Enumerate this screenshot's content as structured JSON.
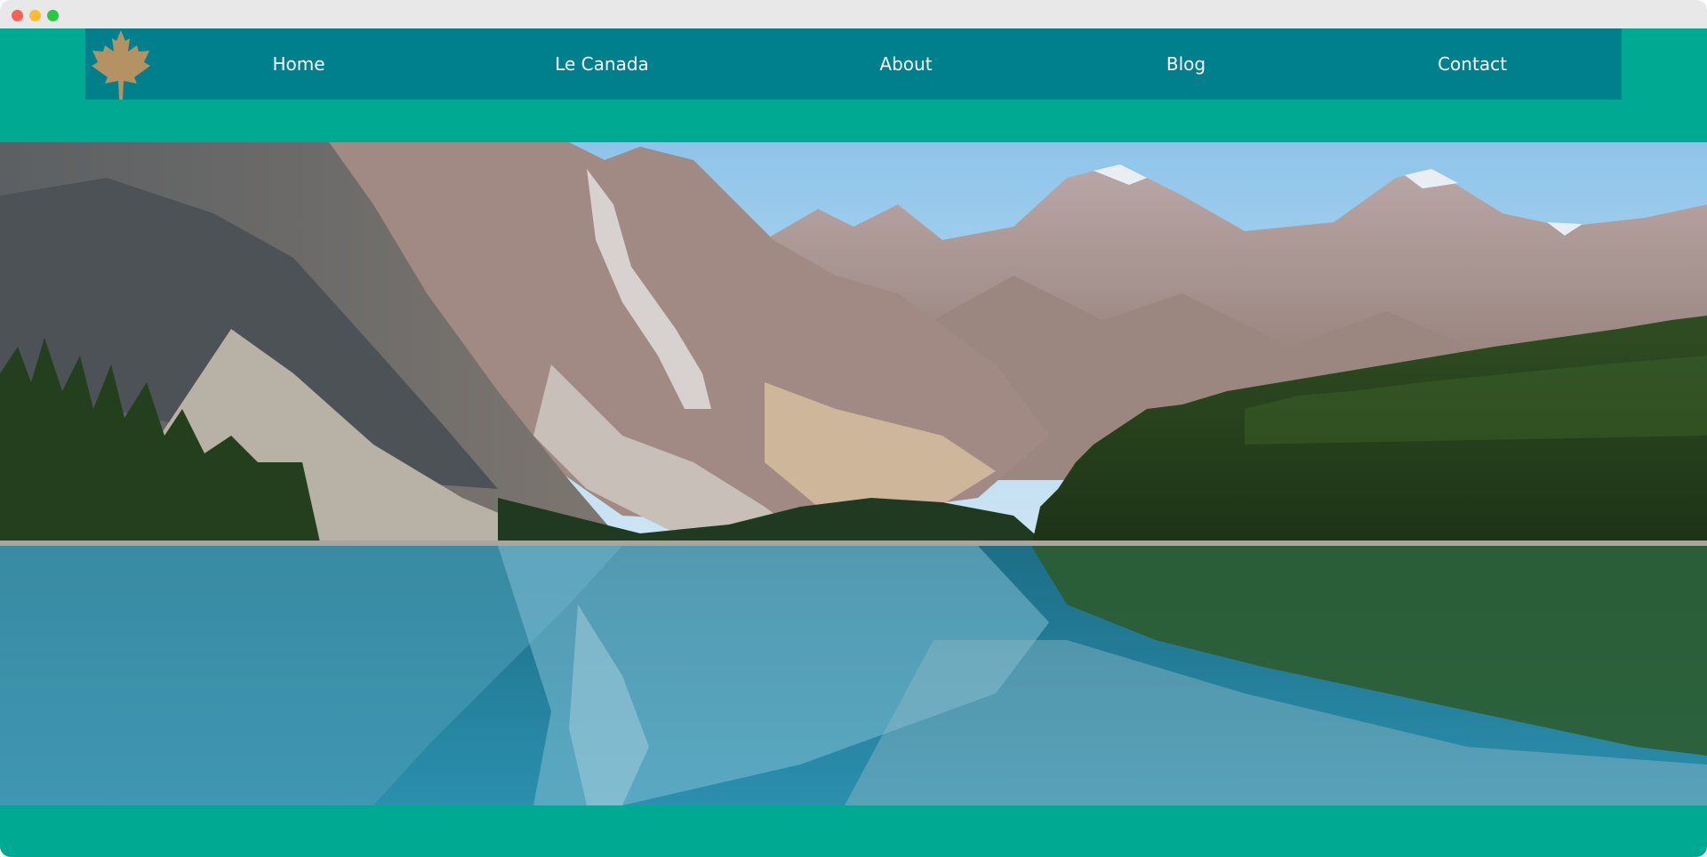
{
  "nav": {
    "logo_icon": "maple-leaf-icon",
    "items": [
      {
        "label": "Home"
      },
      {
        "label": "Le Canada"
      },
      {
        "label": "About"
      },
      {
        "label": "Blog"
      },
      {
        "label": "Contact"
      }
    ]
  },
  "hero": {
    "icon": "mountain-lake-image"
  },
  "colors": {
    "page_background": "#00a991",
    "navbar_background": "#007f8c",
    "logo_color": "#b49263",
    "nav_text": "#ffffff"
  }
}
